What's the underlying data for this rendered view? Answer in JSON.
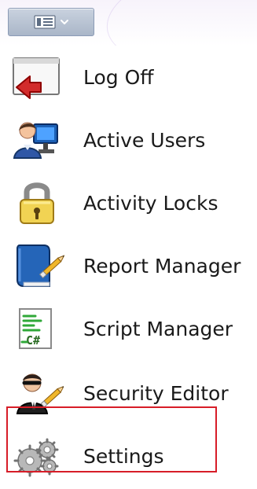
{
  "toolbar": {
    "button_icon": "menu-layout-icon"
  },
  "menu": {
    "items": [
      {
        "id": "log-off",
        "label": "Log Off",
        "icon": "log-off-icon"
      },
      {
        "id": "active-users",
        "label": "Active Users",
        "icon": "users-monitor-icon"
      },
      {
        "id": "activity-locks",
        "label": "Activity Locks",
        "icon": "padlock-icon"
      },
      {
        "id": "report-manager",
        "label": "Report Manager",
        "icon": "book-pencil-icon"
      },
      {
        "id": "script-manager",
        "label": "Script Manager",
        "icon": "csharp-script-icon"
      },
      {
        "id": "security-editor",
        "label": "Security Editor",
        "icon": "security-agent-icon",
        "highlighted": true
      },
      {
        "id": "settings",
        "label": "Settings",
        "icon": "gears-icon"
      }
    ]
  },
  "colors": {
    "highlight_border": "#d71d28",
    "toolbar_background": "#b6c1d1",
    "text": "#1a1a1a"
  }
}
